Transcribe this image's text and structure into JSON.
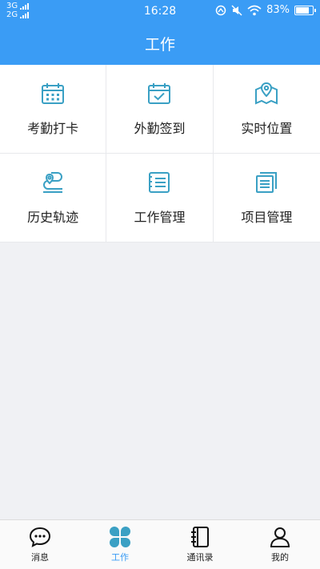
{
  "status_bar": {
    "net1": "3G",
    "net2": "2G",
    "time": "16:28",
    "battery": "83%",
    "battery_level": 0.83
  },
  "header": {
    "title": "工作"
  },
  "grid": {
    "items": [
      {
        "label": "考勤打卡",
        "icon": "calendar-grid-icon"
      },
      {
        "label": "外勤签到",
        "icon": "calendar-check-icon"
      },
      {
        "label": "实时位置",
        "icon": "map-pin-icon"
      },
      {
        "label": "历史轨迹",
        "icon": "route-icon"
      },
      {
        "label": "工作管理",
        "icon": "list-icon"
      },
      {
        "label": "项目管理",
        "icon": "stacked-list-icon"
      }
    ]
  },
  "tabbar": {
    "items": [
      {
        "label": "消息",
        "icon": "chat-bubble-icon"
      },
      {
        "label": "工作",
        "icon": "clover-icon",
        "active": true
      },
      {
        "label": "通讯录",
        "icon": "address-book-icon"
      },
      {
        "label": "我的",
        "icon": "user-icon"
      }
    ]
  },
  "colors": {
    "accent": "#3a9cf5",
    "icon_teal": "#3aa0c4"
  }
}
